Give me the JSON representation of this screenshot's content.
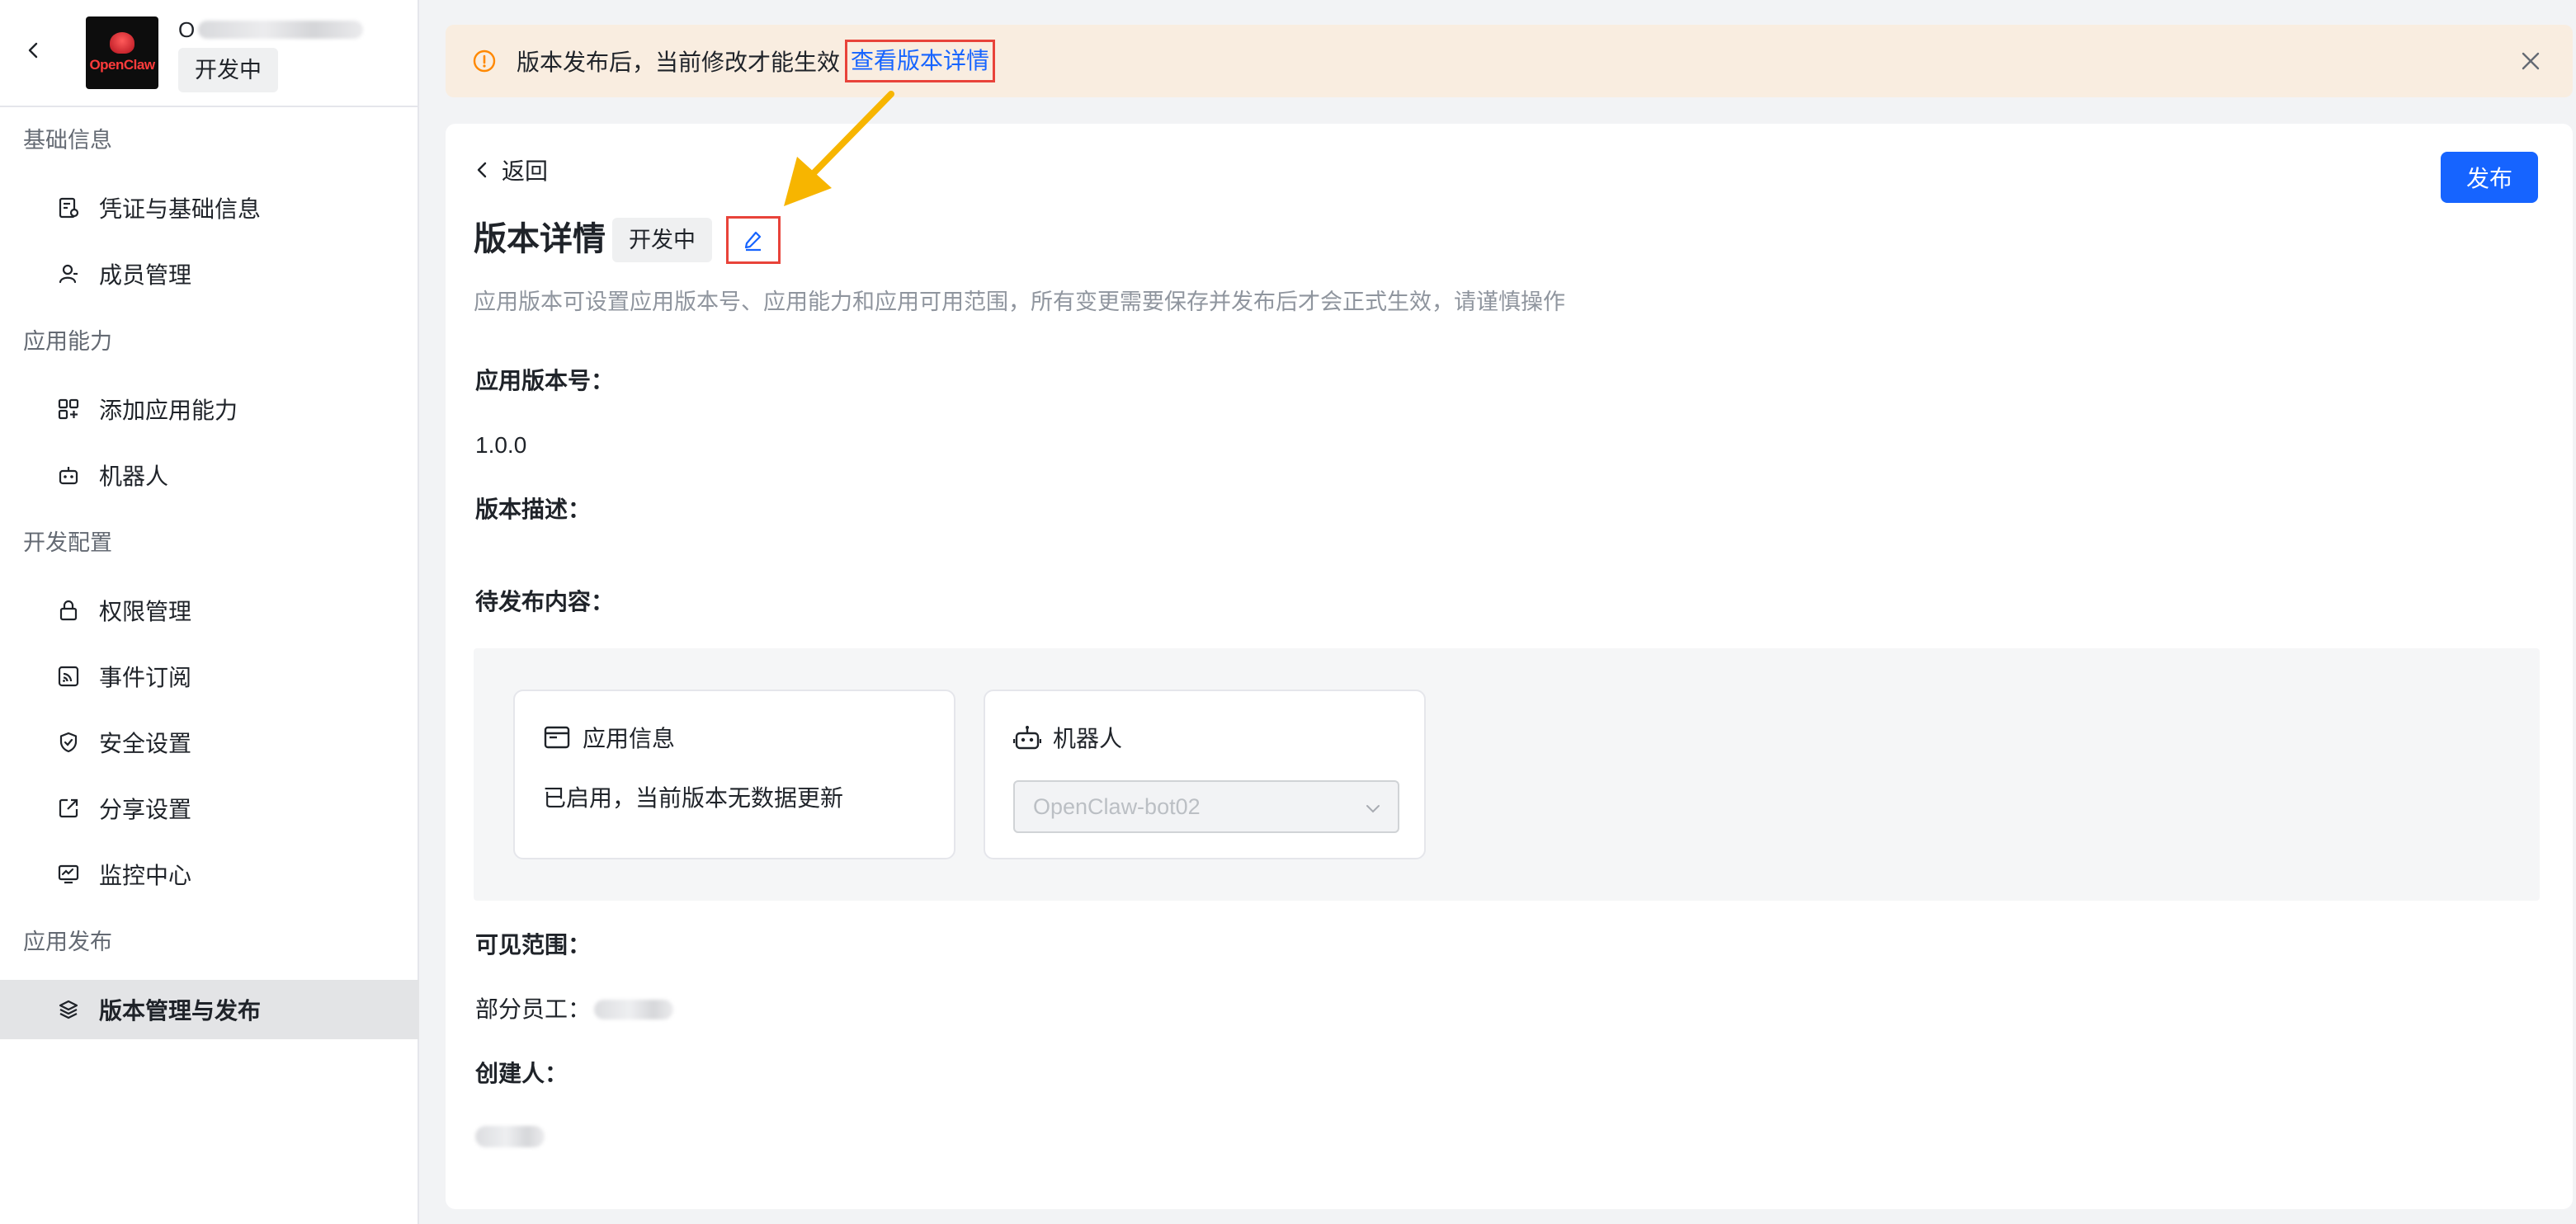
{
  "app": {
    "name_initial": "O",
    "status": "开发中",
    "logo_text": "OpenClaw"
  },
  "sidebar": {
    "groups": [
      {
        "title": "基础信息",
        "items": [
          {
            "label": "凭证与基础信息",
            "icon": "credential-icon"
          },
          {
            "label": "成员管理",
            "icon": "member-icon"
          }
        ]
      },
      {
        "title": "应用能力",
        "items": [
          {
            "label": "添加应用能力",
            "icon": "add-capability-icon"
          },
          {
            "label": "机器人",
            "icon": "robot-icon"
          }
        ]
      },
      {
        "title": "开发配置",
        "items": [
          {
            "label": "权限管理",
            "icon": "lock-icon"
          },
          {
            "label": "事件订阅",
            "icon": "rss-icon"
          },
          {
            "label": "安全设置",
            "icon": "shield-icon"
          },
          {
            "label": "分享设置",
            "icon": "share-icon"
          },
          {
            "label": "监控中心",
            "icon": "monitor-icon"
          }
        ]
      },
      {
        "title": "应用发布",
        "items": [
          {
            "label": "版本管理与发布",
            "icon": "layers-icon",
            "active": true
          }
        ]
      }
    ]
  },
  "notice": {
    "text": "版本发布后，当前修改才能生效",
    "link": "查看版本详情"
  },
  "main": {
    "back_label": "返回",
    "publish_label": "发布",
    "title": "版本详情",
    "status": "开发中",
    "subtitle": "应用版本可设置应用版本号、应用能力和应用可用范围，所有变更需要保存并发布后才会正式生效，请谨慎操作",
    "version_label": "应用版本号：",
    "version_value": "1.0.0",
    "desc_label": "版本描述：",
    "pending_label": "待发布内容：",
    "cards": {
      "app_info": {
        "title": "应用信息",
        "desc": "已启用，当前版本无数据更新"
      },
      "robot": {
        "title": "机器人",
        "select_value": "OpenClaw-bot02"
      }
    },
    "scope_label": "可见范围：",
    "scope_value_prefix": "部分员工：",
    "creator_label": "创建人："
  },
  "colors": {
    "accent": "#1664ff",
    "highlight_border": "#e8433a",
    "arrow": "#f7b500",
    "notice_bg": "#f9ede0"
  }
}
